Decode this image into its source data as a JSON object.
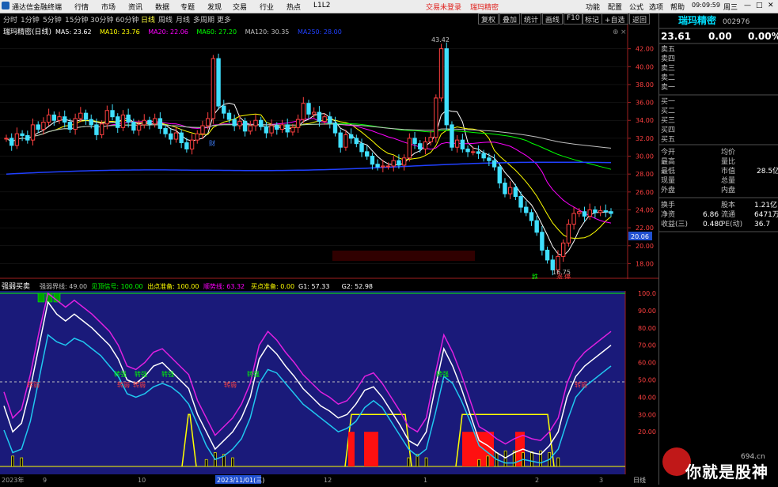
{
  "app": {
    "name": "通达信金融终端",
    "menu": [
      "行情",
      "市场",
      "资讯",
      "数据",
      "专题",
      "发现",
      "交易",
      "行业",
      "热点",
      "L1L2"
    ],
    "trade_login": "交易未登录",
    "stock_tag": "瑞玛精密",
    "right_menu": [
      "功能",
      "配置",
      "公式",
      "选项",
      "帮助"
    ],
    "time": "09:09:59",
    "weekday": "周三"
  },
  "toolbar": {
    "periods": [
      "分时",
      "1分钟",
      "5分钟",
      "15分钟",
      "30分钟",
      "60分钟",
      "日线",
      "周线",
      "月线",
      "多周期",
      "更多"
    ],
    "active_period": "日线",
    "right_buttons": [
      "复权",
      "叠加",
      "统计",
      "画线",
      "F10",
      "标记",
      "+自选",
      "返回"
    ]
  },
  "main_chart": {
    "title": "瑞玛精密(日线)",
    "ma": [
      {
        "label": "MA5: 23.62",
        "color": "#ffffff"
      },
      {
        "label": "MA10: 23.76",
        "color": "#ffff00"
      },
      {
        "label": "MA20: 22.06",
        "color": "#ff00ff"
      },
      {
        "label": "MA60: 27.20",
        "color": "#00ff00"
      },
      {
        "label": "MA120: 30.35",
        "color": "#c0c0c0"
      },
      {
        "label": "MA250: 28.00",
        "color": "#2040ff"
      }
    ],
    "ylim": [
      16.8,
      44
    ],
    "yticks": [
      "42.00",
      "40.00",
      "38.00",
      "36.00",
      "34.00",
      "32.00",
      "30.00",
      "28.00",
      "26.00",
      "24.00",
      "22.00",
      "20.00",
      "18.00"
    ],
    "high_label": "43.42",
    "low_label": "16.75",
    "last_price_tag": "20.06",
    "marks": {
      "m1": "财",
      "m2": "跌",
      "m3": "涨",
      "m4": "停"
    }
  },
  "chart_data": [
    {
      "type": "candlestick",
      "title": "瑞玛精密(日线)",
      "ylim": [
        16.8,
        44
      ],
      "high": 43.42,
      "low": 16.75,
      "series": [
        {
          "name": "MA5",
          "last": 23.62
        },
        {
          "name": "MA10",
          "last": 23.76
        },
        {
          "name": "MA20",
          "last": 22.06
        },
        {
          "name": "MA60",
          "last": 27.2
        },
        {
          "name": "MA120",
          "last": 30.35
        },
        {
          "name": "MA250",
          "last": 28.0
        }
      ],
      "close": [
        32.0,
        31.2,
        32.5,
        32.3,
        31.8,
        33.5,
        33.0,
        33.8,
        34.6,
        34.0,
        34.4,
        33.8,
        33.0,
        34.2,
        34.8,
        34.1,
        33.5,
        32.4,
        33.6,
        35.1,
        34.4,
        33.2,
        34.6,
        33.8,
        32.9,
        33.5,
        34.0,
        33.6,
        34.2,
        33.1,
        32.5,
        31.9,
        32.6,
        31.5,
        30.8,
        31.8,
        32.5,
        33.4,
        34.2,
        40.9,
        35.6,
        34.8,
        34.1,
        33.4,
        33.9,
        32.8,
        33.4,
        34.0,
        33.3,
        32.6,
        33.4,
        33.0,
        33.5,
        32.7,
        33.2,
        34.1,
        35.9,
        34.7,
        34.9,
        33.9,
        34.4,
        33.7,
        32.6,
        31.0,
        32.4,
        32.0,
        31.4,
        30.5,
        30.0,
        29.1,
        28.8,
        28.9,
        28.9,
        29.5,
        29.0,
        29.8,
        32.0,
        31.4,
        30.8,
        31.6,
        32.1,
        36.5,
        42.0,
        33.5,
        31.0,
        31.8,
        30.8,
        30.5,
        30.5,
        30.3,
        29.8,
        29.5,
        28.8,
        27.0,
        25.8,
        26.5,
        25.5,
        24.3,
        23.7,
        22.8,
        21.5,
        19.5,
        18.4,
        17.3,
        18.8,
        20.3,
        22.4,
        23.6,
        23.8,
        23.3,
        24.0,
        23.7,
        23.9,
        23.8,
        23.6
      ],
      "ylabel": "",
      "xlabel": ""
    },
    {
      "type": "line",
      "title": "强弱买卖",
      "ylim": [
        0,
        100
      ],
      "yticks": [
        100,
        90,
        80,
        70,
        60,
        50,
        40,
        30,
        20
      ],
      "series": [
        {
          "name": "强弱界线",
          "value": 49.0
        },
        {
          "name": "见顶信号",
          "value": 100.0
        },
        {
          "name": "出点准备",
          "value": 100.0
        },
        {
          "name": "顺势线",
          "value": 63.32
        },
        {
          "name": "买点准备",
          "value": 0.0
        },
        {
          "name": "G1",
          "value": 57.33
        },
        {
          "name": "G2",
          "value": 52.98
        }
      ],
      "g1": [
        35,
        20,
        25,
        45,
        70,
        95,
        88,
        84,
        88,
        84,
        80,
        75,
        70,
        62,
        50,
        48,
        52,
        58,
        60,
        55,
        50,
        45,
        30,
        20,
        10,
        15,
        20,
        28,
        40,
        62,
        70,
        65,
        58,
        52,
        45,
        40,
        35,
        32,
        28,
        30,
        36,
        44,
        46,
        40,
        32,
        24,
        15,
        12,
        20,
        45,
        68,
        58,
        45,
        30,
        15,
        12,
        8,
        5,
        8,
        10,
        8,
        7,
        12,
        20,
        40,
        52,
        58,
        62,
        66,
        70
      ],
      "g2": [
        25,
        12,
        14,
        30,
        55,
        80,
        76,
        74,
        78,
        76,
        72,
        68,
        62,
        56,
        46,
        44,
        46,
        50,
        52,
        50,
        46,
        40,
        28,
        16,
        8,
        10,
        14,
        20,
        32,
        52,
        60,
        58,
        52,
        46,
        40,
        36,
        32,
        28,
        24,
        26,
        30,
        38,
        42,
        38,
        30,
        22,
        14,
        10,
        14,
        34,
        56,
        52,
        42,
        30,
        16,
        12,
        8,
        6,
        6,
        8,
        7,
        6,
        8,
        14,
        30,
        44,
        50,
        54,
        58,
        62
      ],
      "xlabel": "",
      "ylabel": ""
    }
  ],
  "sub_chart": {
    "title": "强弱买卖",
    "indicators": [
      {
        "label": "强弱界线: 49.00",
        "color": "#c0c0c0"
      },
      {
        "label": "见顶信号: 100.00",
        "color": "#00ff00"
      },
      {
        "label": "出点准备: 100.00",
        "color": "#ffff00"
      },
      {
        "label": "顺势线: 63.32",
        "color": "#ff00ff"
      },
      {
        "label": "买点准备: 0.00",
        "color": "#ffff00"
      },
      {
        "label": "G1: 57.33",
        "color": "#ffffff"
      },
      {
        "label": "G2: 52.98",
        "color": "#ffffff"
      }
    ],
    "yticks": [
      "100.0",
      "90.00",
      "80.00",
      "70.00",
      "60.00",
      "50.00",
      "40.00",
      "30.00",
      "20.00"
    ],
    "labels": {
      "zhuanqiang": "转强",
      "zhuanruo": "转弱"
    }
  },
  "x_axis": {
    "labels": [
      "2023年",
      "9",
      "10",
      "2023/11/01(三)",
      "12",
      "1",
      "2",
      "3"
    ],
    "period": "日线"
  },
  "quote": {
    "name": "瑞玛精密",
    "code": "002976",
    "price": "23.61",
    "change": "0.00",
    "change_pct": "0.00%",
    "sell": [
      "卖五",
      "卖四",
      "卖三",
      "卖二",
      "卖一"
    ],
    "buy": [
      "买一",
      "买二",
      "买三",
      "买四",
      "买五"
    ],
    "stats": [
      [
        "今开",
        "",
        "均价",
        ""
      ],
      [
        "最高",
        "",
        "量比",
        ""
      ],
      [
        "最低",
        "",
        "市值",
        "28.5亿"
      ],
      [
        "现量",
        "",
        "总量",
        ""
      ],
      [
        "外盘",
        "",
        "内盘",
        ""
      ]
    ],
    "stats2": [
      [
        "换手",
        "",
        "股本",
        "1.21亿"
      ],
      [
        "净资",
        "6.86",
        "流通",
        "6471万"
      ],
      [
        "收益(三)",
        "0.480",
        "PE(动)",
        "36.7"
      ]
    ]
  },
  "watermark": {
    "text": "你就是股神",
    "site": "694.cn"
  }
}
